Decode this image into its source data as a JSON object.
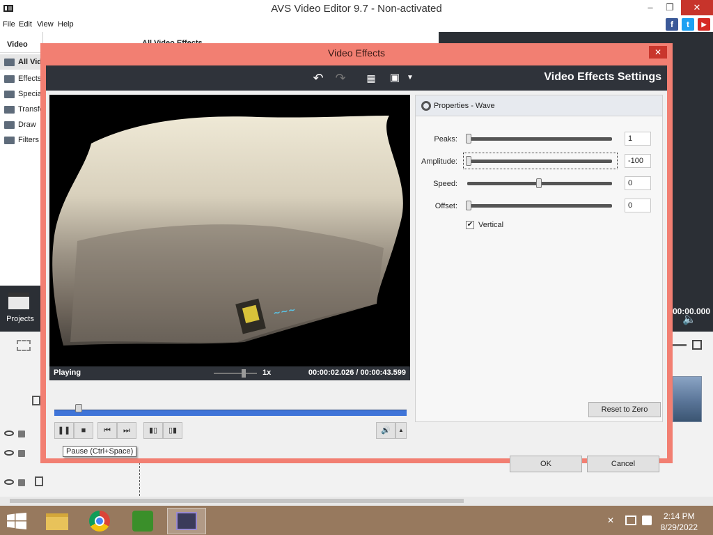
{
  "window": {
    "title": "AVS Video Editor 9.7 - Non-activated",
    "minimize": "–",
    "maximize": "❐",
    "close": "✕"
  },
  "menu": [
    "File",
    "Edit",
    "View",
    "Help"
  ],
  "social": [
    {
      "name": "facebook",
      "glyph": "f",
      "color": "#3b5998"
    },
    {
      "name": "twitter",
      "glyph": "t",
      "color": "#1da1f2"
    },
    {
      "name": "youtube",
      "glyph": "▶",
      "color": "#d52a24"
    }
  ],
  "left_panel": {
    "title": "Video Effects",
    "categories": [
      "All Video Effects",
      "Effects",
      "Special",
      "Transform",
      "Draw",
      "Filters"
    ],
    "selected_index": 0
  },
  "behind_header": "All Video Effects",
  "right_time": "00:00.000",
  "projects_label": "Projects",
  "dialog": {
    "title": "Video Effects",
    "settings_title": "Video Effects Settings",
    "status": "Playing",
    "speed": "1x",
    "time_current": "00:00:02.026",
    "time_sep": "/",
    "time_total": "00:00:43.599",
    "tooltip": "Pause (Ctrl+Space)",
    "props_title": "Properties - Wave",
    "properties": [
      {
        "label": "Peaks:",
        "value": "1",
        "level": 0.0
      },
      {
        "label": "Amplitude:",
        "value": "-100",
        "level": 0.0
      },
      {
        "label": "Speed:",
        "value": "0",
        "level": 0.5
      },
      {
        "label": "Offset:",
        "value": "0",
        "level": 0.0
      }
    ],
    "checkbox_label": "Vertical",
    "checkbox_checked": true,
    "reset_label": "Reset to Zero",
    "ok_label": "OK",
    "cancel_label": "Cancel",
    "playback_progress": 0.05
  },
  "clock": {
    "time": "2:14 PM",
    "date": "8/29/2022"
  }
}
